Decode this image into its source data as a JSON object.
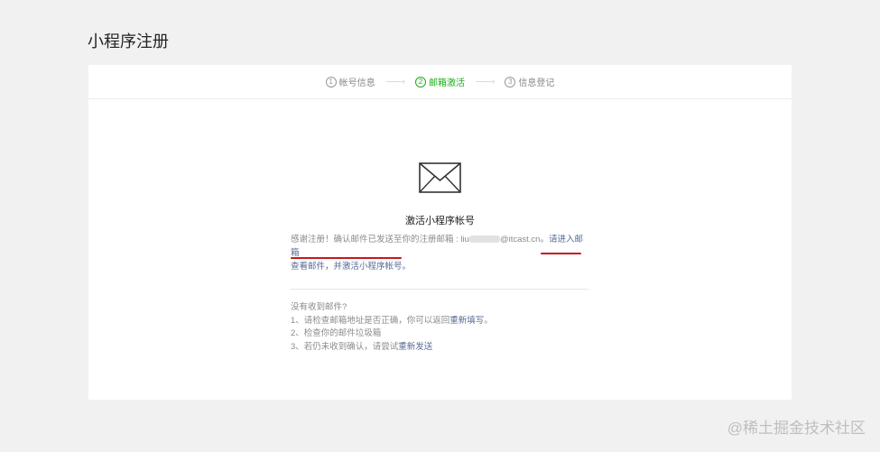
{
  "page": {
    "title": "小程序注册"
  },
  "steps": [
    {
      "num": "1",
      "label": "帐号信息",
      "active": false
    },
    {
      "num": "2",
      "label": "邮箱激活",
      "active": true
    },
    {
      "num": "3",
      "label": "信息登记",
      "active": false
    }
  ],
  "step_arrow": "——›",
  "activation": {
    "title": "激活小程序帐号",
    "message_prefix": "感谢注册！确认邮件已发送至你的注册邮箱 : liu",
    "email_domain": "@itcast.cn",
    "message_sep": "。",
    "link_part1": "请进入邮箱",
    "link_part2": "查看邮件，并激活小程序帐号。"
  },
  "help": {
    "heading": "没有收到邮件?",
    "item1_text": "1、请检查邮箱地址是否正确，你可以返回",
    "item1_link": "重新填写",
    "item1_end": "。",
    "item2_text": "2、检查你的邮件垃圾箱",
    "item3_text": "3、若仍未收到确认，请尝试",
    "item3_link": "重新发送"
  },
  "watermark": "@稀土掘金技术社区",
  "colors": {
    "accent_green": "#1aad19",
    "link": "#576b95",
    "annotation_red": "#c8161d"
  }
}
